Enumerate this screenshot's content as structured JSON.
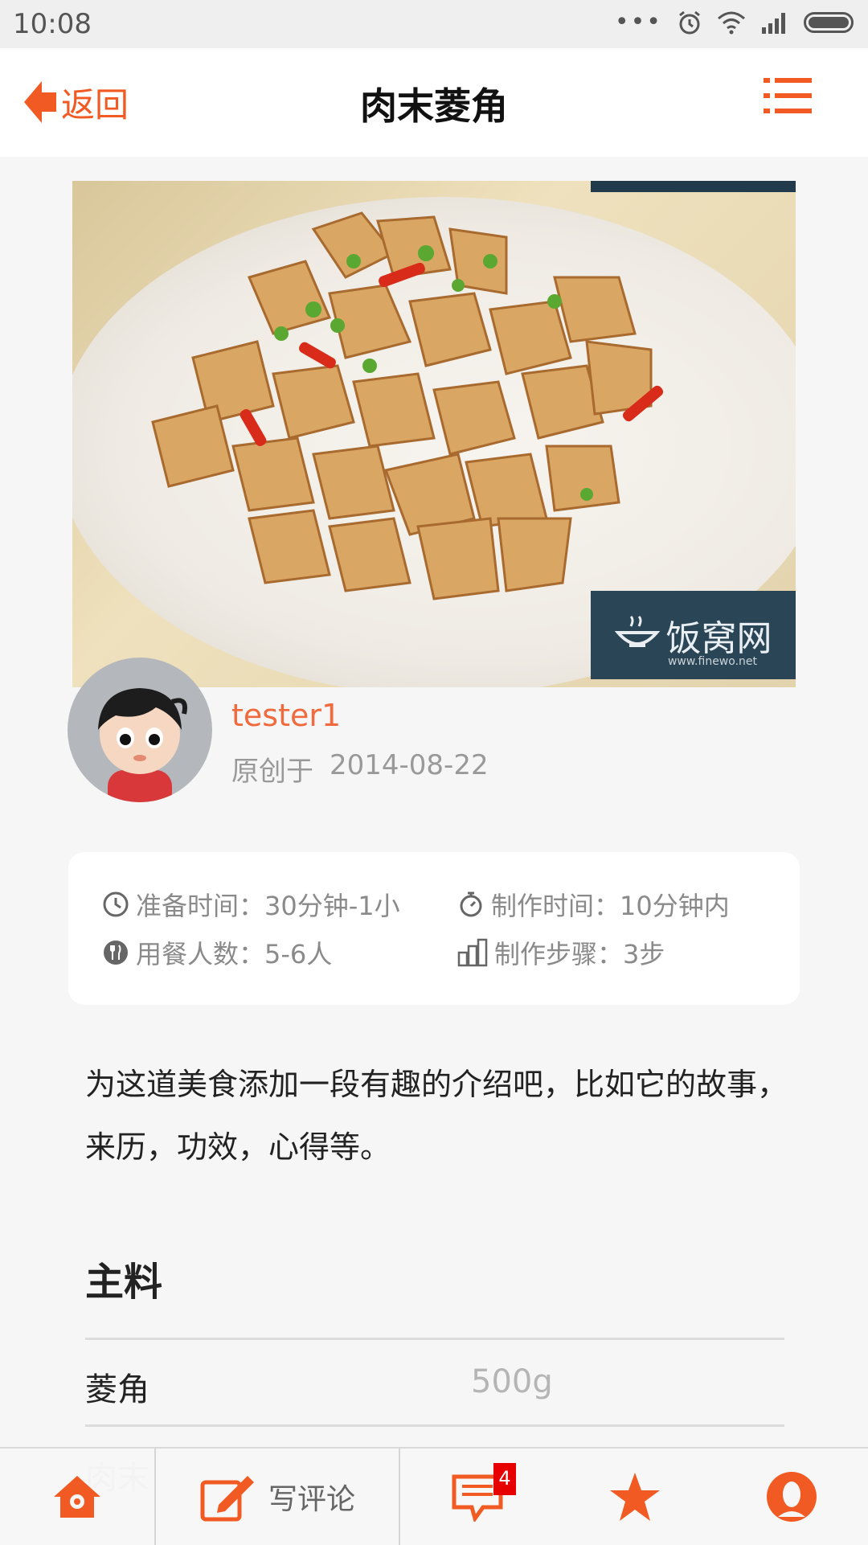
{
  "status": {
    "time": "10:08",
    "dots": "•••"
  },
  "header": {
    "back_label": "返回",
    "title": "肉末菱角"
  },
  "hero": {
    "watermark_text": "饭窝网",
    "watermark_url": "www.finewo.net"
  },
  "author": {
    "name": "tester1",
    "date_prefix": "原创于",
    "date": "2014-08-22"
  },
  "info": {
    "prep_time": "准备时间：30分钟-1小",
    "cook_time": "制作时间：10分钟内",
    "servings": "用餐人数：5-6人",
    "steps": "制作步骤：3步"
  },
  "intro": "为这道美食添加一段有趣的介绍吧，比如它的故事，来历，功效，心得等。",
  "ingredients": {
    "title": "主料",
    "items": [
      {
        "name": "菱角",
        "qty": "500g"
      },
      {
        "name": "肉末",
        "qty": ""
      }
    ]
  },
  "bottom_bar": {
    "comment_label": "写评论",
    "badge_count": "4"
  },
  "colors": {
    "accent": "#f15a22",
    "author": "#f06a3e",
    "badge": "#e60000"
  }
}
